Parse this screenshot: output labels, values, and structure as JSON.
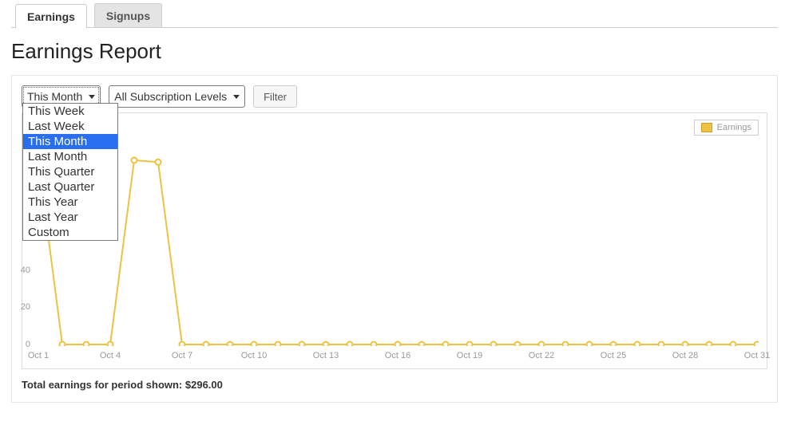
{
  "tabs": [
    {
      "label": "Earnings",
      "active": true
    },
    {
      "label": "Signups",
      "active": false
    }
  ],
  "page_title": "Earnings Report",
  "controls": {
    "date_range": {
      "selected": "This Month",
      "options": [
        "This Week",
        "Last Week",
        "This Month",
        "Last Month",
        "This Quarter",
        "Last Quarter",
        "This Year",
        "Last Year",
        "Custom"
      ]
    },
    "level": {
      "selected": "All Subscription Levels"
    },
    "filter_label": "Filter"
  },
  "legend_label": "Earnings",
  "totals_line": "Total earnings for period shown: $296.00",
  "chart_data": {
    "type": "line",
    "title": "",
    "xlabel": "",
    "ylabel": "",
    "ylim": [
      0,
      120
    ],
    "yticks": [
      0,
      20,
      40
    ],
    "x": [
      1,
      2,
      3,
      4,
      5,
      6,
      7,
      8,
      9,
      10,
      11,
      12,
      13,
      14,
      15,
      16,
      17,
      18,
      19,
      20,
      21,
      22,
      23,
      24,
      25,
      26,
      27,
      28,
      29,
      30,
      31
    ],
    "x_tick_labels": {
      "1": "Oct 1",
      "4": "Oct 4",
      "7": "Oct 7",
      "10": "Oct 10",
      "13": "Oct 13",
      "16": "Oct 16",
      "19": "Oct 19",
      "22": "Oct 22",
      "25": "Oct 25",
      "28": "Oct 28",
      "31": "Oct 31"
    },
    "series": [
      {
        "name": "Earnings",
        "color": "#edc240",
        "values": [
          99,
          0,
          0,
          0,
          99,
          98,
          0,
          0,
          0,
          0,
          0,
          0,
          0,
          0,
          0,
          0,
          0,
          0,
          0,
          0,
          0,
          0,
          0,
          0,
          0,
          0,
          0,
          0,
          0,
          0,
          0
        ]
      }
    ]
  }
}
